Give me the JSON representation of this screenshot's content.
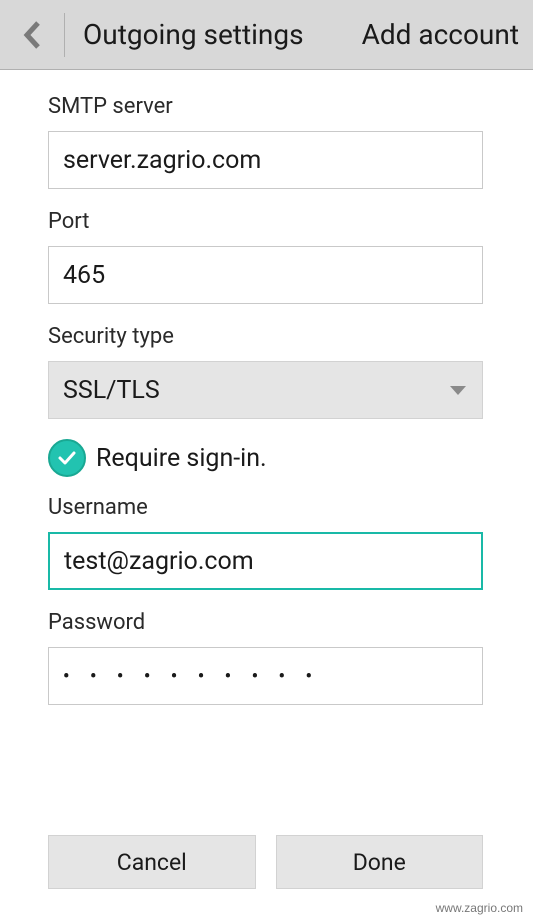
{
  "header": {
    "title": "Outgoing settings",
    "right": "Add account"
  },
  "form": {
    "smtp_label": "SMTP server",
    "smtp_value": "server.zagrio.com",
    "port_label": "Port",
    "port_value": "465",
    "security_label": "Security type",
    "security_value": "SSL/TLS",
    "require_signin_label": "Require sign-in.",
    "username_label": "Username",
    "username_value": "test@zagrio.com",
    "password_label": "Password",
    "password_masked": "• • • • • • • • • •"
  },
  "footer": {
    "cancel": "Cancel",
    "done": "Done"
  },
  "watermark": "www.zagrio.com"
}
